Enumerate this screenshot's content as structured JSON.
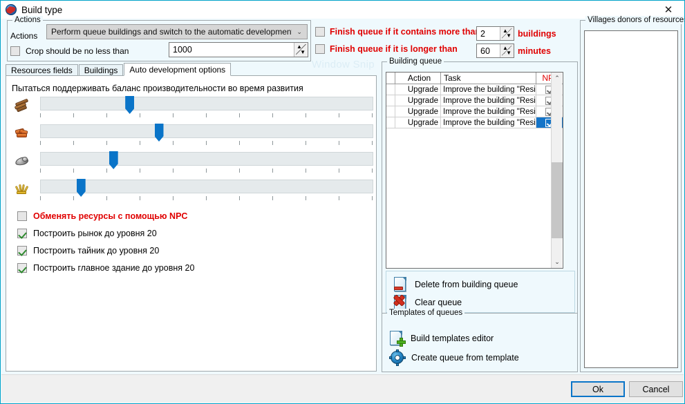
{
  "window": {
    "title": "Build type",
    "icon": "app-globe-icon",
    "close_label": "✕",
    "watermark": "Window Snip",
    "accent": "#00a2c8"
  },
  "actions": {
    "group_title": "Actions",
    "field_label": "Actions",
    "combo_value": "Perform queue buildings and switch to the automatic development",
    "combo_arrow": "⌄",
    "crop_checkbox_label": "Crop should be no less than",
    "crop_checked": false,
    "crop_value": "1000"
  },
  "finish_options": [
    {
      "label": "Finish queue if it contains more than",
      "checked": false,
      "value": "2",
      "unit": "buildings"
    },
    {
      "label": "Finish queue if it is longer than",
      "checked": false,
      "value": "60",
      "unit": "minutes"
    }
  ],
  "tabs": [
    {
      "label": "Resources fields",
      "active": false
    },
    {
      "label": "Buildings",
      "active": false
    },
    {
      "label": "Auto development options",
      "active": true
    }
  ],
  "auto_dev": {
    "balance_caption": "Пытаться поддерживать баланс производительности во время развития",
    "sliders": [
      {
        "resource": "wood",
        "icon": "wood-icon",
        "percent": 26
      },
      {
        "resource": "clay",
        "icon": "clay-icon",
        "percent": 35
      },
      {
        "resource": "iron",
        "icon": "iron-icon",
        "percent": 21
      },
      {
        "resource": "crop",
        "icon": "crop-icon",
        "percent": 11
      }
    ],
    "tick_count": 11,
    "options": [
      {
        "label": "Обменять ресурсы с помощью NPC",
        "checked": false,
        "red": true
      },
      {
        "label": "Построить рынок до уровня 20",
        "checked": true,
        "red": false
      },
      {
        "label": "Построить тайник до уровня 20",
        "checked": true,
        "red": false
      },
      {
        "label": "Построить главное здание до уровня 20",
        "checked": true,
        "red": false
      }
    ]
  },
  "building_queue": {
    "group_title": "Building queue",
    "columns": [
      "",
      "Action",
      "Task",
      "NPC"
    ],
    "rows": [
      {
        "action": "Upgrade",
        "task": "Improve the building \"Residenc",
        "npc": true,
        "selected": false
      },
      {
        "action": "Upgrade",
        "task": "Improve the building \"Residenc",
        "npc": true,
        "selected": false
      },
      {
        "action": "Upgrade",
        "task": "Improve the building \"Residenc",
        "npc": true,
        "selected": false
      },
      {
        "action": "Upgrade",
        "task": "Improve the building \"Residenc",
        "npc": true,
        "selected": true
      }
    ],
    "scroll_up": "⌃",
    "scroll_down": "⌄",
    "actions": [
      {
        "label": "Delete from building queue",
        "icon": "file-delete-icon"
      },
      {
        "label": "Clear queue",
        "icon": "file-clear-icon"
      }
    ]
  },
  "templates": {
    "group_title": "Templates of queues",
    "items": [
      {
        "label": "Build templates editor",
        "icon": "file-add-icon"
      },
      {
        "label": "Create queue from template",
        "icon": "gear-icon"
      }
    ]
  },
  "donors": {
    "group_title": "Villages donors of resources",
    "items": []
  },
  "footer": {
    "ok_label": "Ok",
    "cancel_label": "Cancel"
  }
}
